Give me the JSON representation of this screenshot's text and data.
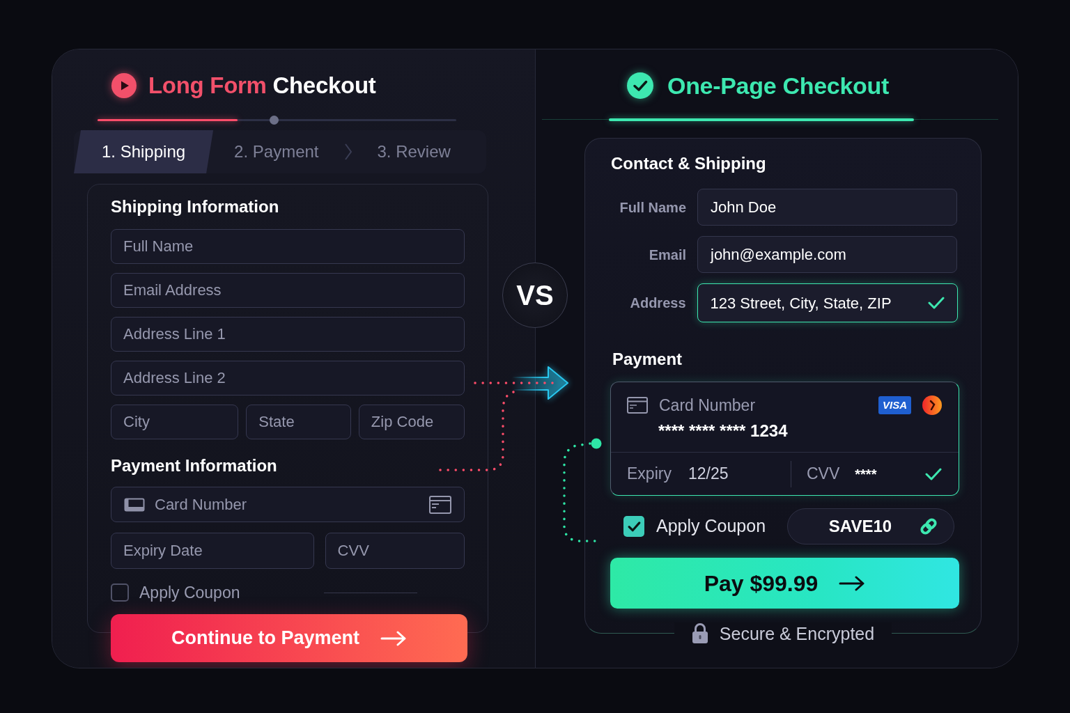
{
  "long_form": {
    "title": {
      "accent": "Long Form",
      "rest": "Checkout"
    },
    "progress": {
      "level": 0.39
    },
    "steps": [
      {
        "label": "1. Shipping",
        "selected": true
      },
      {
        "label": "2. Payment",
        "selected": false
      },
      {
        "label": "3. Review",
        "selected": false
      }
    ],
    "shipping": {
      "heading": "Shipping Information",
      "rows": [
        [
          {
            "kind": "text",
            "placeholder": "Full Name"
          }
        ],
        [
          {
            "kind": "text",
            "placeholder": "Email Address"
          }
        ],
        [
          {
            "kind": "text",
            "placeholder": "Address Line 1"
          }
        ],
        [
          {
            "kind": "text",
            "placeholder": "Address Line 2"
          }
        ],
        [
          {
            "kind": "text",
            "placeholder": "City"
          },
          {
            "kind": "text",
            "placeholder": "State"
          },
          {
            "kind": "text",
            "placeholder": "Zip Code"
          }
        ]
      ]
    },
    "payment": {
      "heading": "Payment Information",
      "rows": [
        [
          {
            "kind": "card",
            "placeholder": "Card Number"
          }
        ],
        [
          {
            "kind": "text",
            "placeholder": "Expiry Date"
          },
          {
            "kind": "text",
            "placeholder": "CVV"
          }
        ]
      ],
      "coupon": {
        "label": "Apply Coupon",
        "checked": false
      }
    },
    "button": "Continue to Payment"
  },
  "divider": {
    "label": "VS"
  },
  "one_page": {
    "title": "One-Page Checkout",
    "contact": {
      "heading": "Contact & Shipping",
      "fields": [
        {
          "label": "Full Name",
          "value": "John Doe",
          "valid": false
        },
        {
          "label": "Email",
          "value": "john@example.com",
          "valid": false
        },
        {
          "label": "Address",
          "value": "123 Street, City, State, ZIP",
          "valid": true
        }
      ]
    },
    "payment": {
      "heading": "Payment",
      "card": {
        "label": "Card Number",
        "number": "**** **** **** 1234",
        "brand": "VISA",
        "expiry_label": "Expiry",
        "expiry": "12/25",
        "cvv_label": "CVV",
        "cvv": "****",
        "valid": true
      }
    },
    "coupon": {
      "label": "Apply Coupon",
      "checked": true,
      "code": "SAVE10"
    },
    "button": "Pay $99.99",
    "security_note": "Secure & Encrypted"
  }
}
